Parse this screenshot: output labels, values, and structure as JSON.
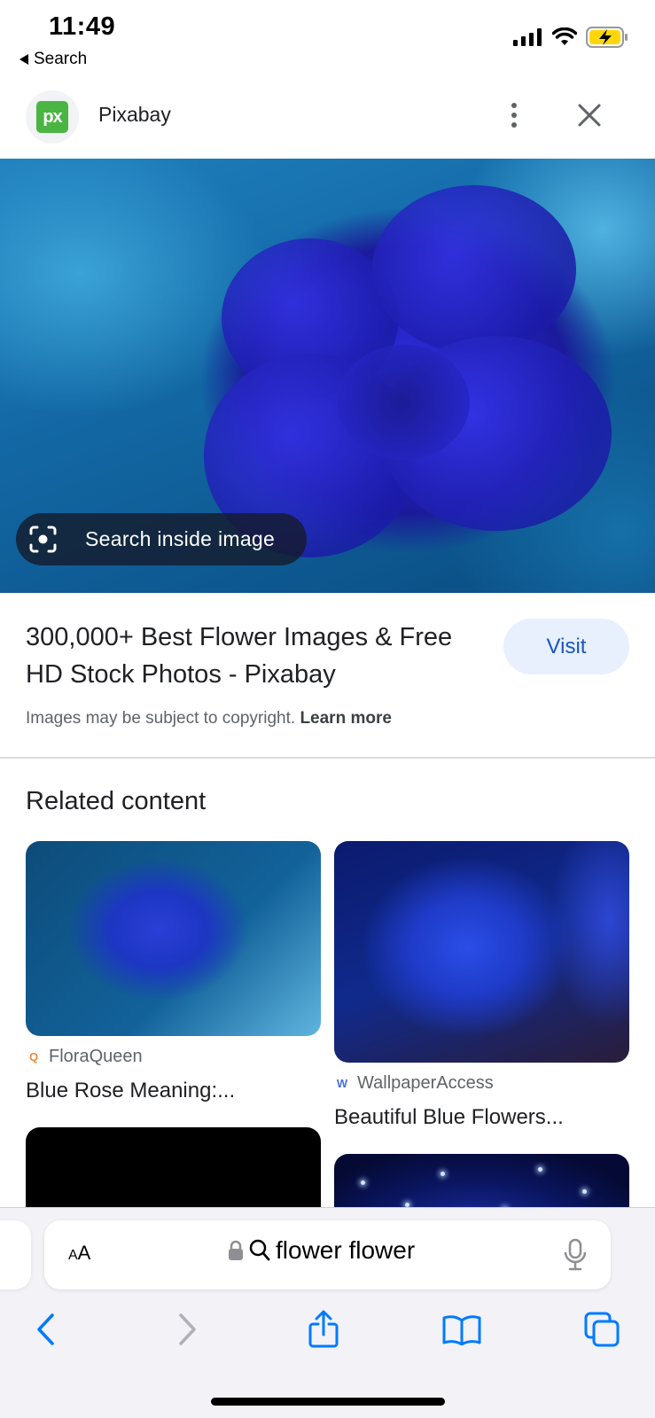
{
  "status_bar": {
    "time": "11:49",
    "back_app_label": "Search",
    "icons": [
      "signal-icon",
      "wifi-icon",
      "battery-charging-icon"
    ]
  },
  "header": {
    "site_logo_text": "px",
    "site_name": "Pixabay",
    "icons": [
      "more-vert-icon",
      "close-icon"
    ]
  },
  "hero": {
    "search_inside_label": "Search inside image",
    "icon": "lens-icon"
  },
  "result": {
    "title": "300,000+ Best Flower Images & Free HD Stock Photos - Pixabay",
    "visit_label": "Visit",
    "copyright_text": "Images may be subject to copyright.",
    "learn_more_label": "Learn more"
  },
  "related": {
    "heading": "Related content",
    "items": [
      {
        "source": "FloraQueen",
        "source_icon": "floraqueen-icon",
        "caption": "Blue Rose Meaning:..."
      },
      {
        "source": "WallpaperAccess",
        "source_icon": "wallpaperaccess-icon",
        "caption": "Beautiful Blue Flowers..."
      }
    ]
  },
  "browser": {
    "text_size_label_small": "A",
    "text_size_label_large": "A",
    "url_text": "flower flower",
    "icons": [
      "lock-icon",
      "search-icon",
      "mic-icon",
      "back-icon",
      "forward-icon",
      "share-icon",
      "bookmarks-icon",
      "tabs-icon"
    ]
  },
  "colors": {
    "accent": "#1a56c0",
    "visit_bg": "#e8f0fe",
    "pixabay_green": "#4bb543",
    "ios_blue": "#007aff"
  }
}
